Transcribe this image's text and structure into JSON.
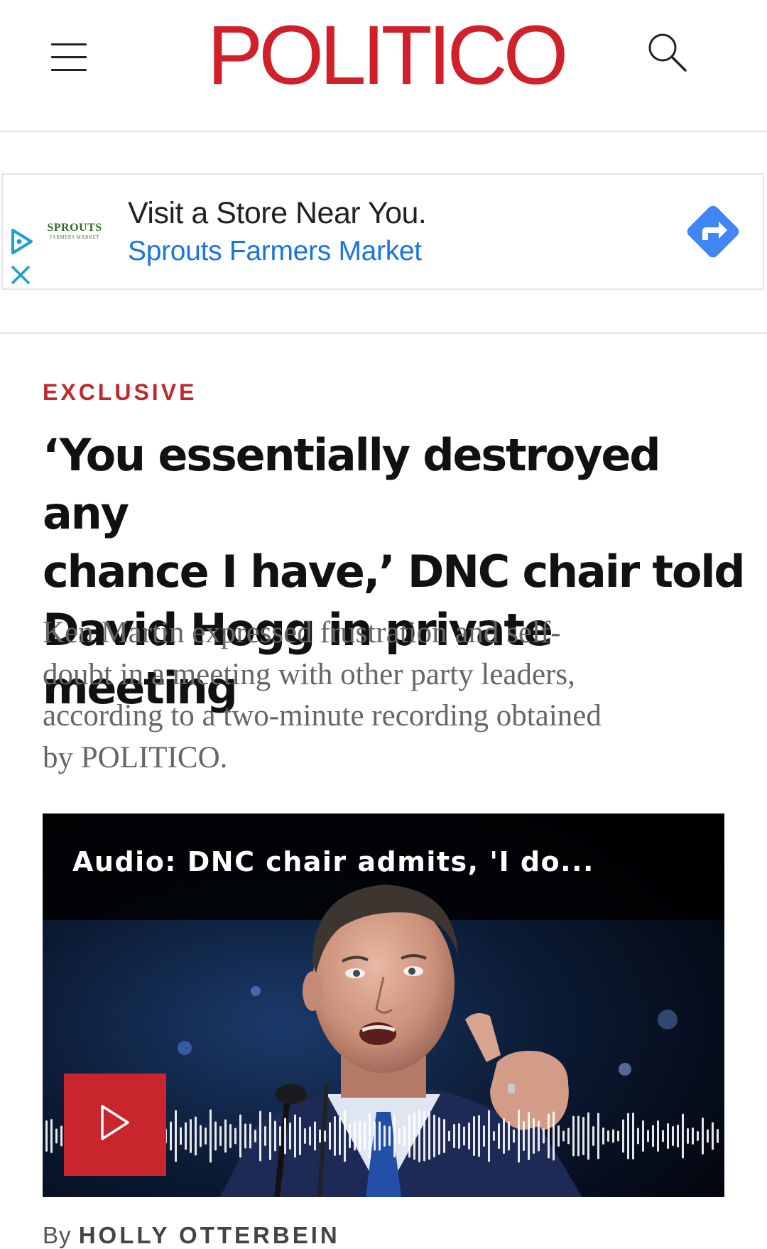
{
  "header": {
    "logo": "POLITICO",
    "menu_icon": "hamburger-menu-icon",
    "search_icon": "search-icon",
    "brand_color": "#d0202a"
  },
  "ad": {
    "logo_name": "SPROUTS",
    "logo_sub": "FARMERS MARKET",
    "headline": "Visit a Store Near You.",
    "brand": "Sprouts Farmers Market",
    "accent_color": "#1a73e8",
    "icons": [
      "adchoices-play-icon",
      "close-icon",
      "directions-icon"
    ]
  },
  "article": {
    "kicker": "EXCLUSIVE",
    "headline_lines": [
      "‘You essentially destroyed any",
      "chance I have,’ DNC chair told",
      "David Hogg in private meeting"
    ],
    "dek_lines": [
      "Ken Martin expressed frustration and self-",
      "doubt in a meeting with other party leaders,",
      "according to a two-minute recording obtained",
      "by POLITICO."
    ],
    "media_title": "Audio: DNC chair admits, 'I do...",
    "media_play_icon": "play-icon",
    "byline_prefix": "By",
    "author": "HOLLY OTTERBEIN",
    "kicker_color": "#c0282d",
    "play_button_color": "#c8262c"
  }
}
